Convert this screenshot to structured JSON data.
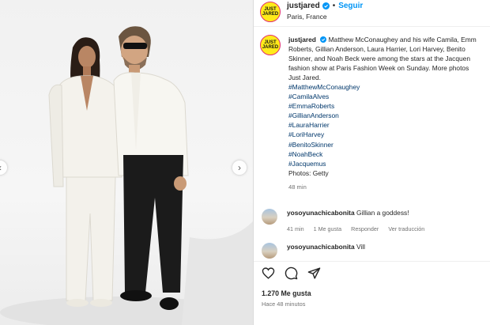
{
  "post": {
    "username": "justjared",
    "follow_label": "Seguir",
    "location": "Paris, France",
    "avatar_text": "JUST JARED"
  },
  "caption": {
    "username": "justjared",
    "lines": [
      "Matthew McConaughey and his wife Camila, Emm",
      "Roberts, Gillian Anderson, Laura Harrier, Lori Harvey, Benito",
      "Skinner, and Noah Beck were among the stars at the Jacquen",
      "fashion show at Paris Fashion Week on Sunday. More photos",
      "Just Jared."
    ],
    "hashtags": [
      "#MatthewMcConaughey",
      "#CamilaAlves",
      "#EmmaRoberts",
      "#GillianAnderson",
      "#LauraHarrier",
      "#LoriHarvey",
      "#BenitoSkinner",
      "#NoahBeck",
      "#Jacquemus"
    ],
    "credit": "Photos: Getty",
    "time": "48 min"
  },
  "comments": [
    {
      "username": "yosoyunachicabonita",
      "text": "Gillian a goddess!",
      "time": "41 min",
      "likes": "1 Me gusta",
      "reply": "Responder",
      "translate": "Ver traducción"
    },
    {
      "username": "yosoyunachicabonita",
      "text": "Vill"
    }
  ],
  "footer": {
    "likes": "1.270 Me gusta",
    "ago": "Hace 48 minutos"
  },
  "colors": {
    "accent": "#0095f6",
    "hashtag": "#00376b",
    "muted": "#737373",
    "avatar_bg": "#ffeb1a"
  },
  "icons": {
    "prev": "chevron-left-icon",
    "next": "chevron-right-icon",
    "like": "heart-icon",
    "comment": "comment-icon",
    "share": "share-icon",
    "verified": "verified-badge-icon"
  }
}
